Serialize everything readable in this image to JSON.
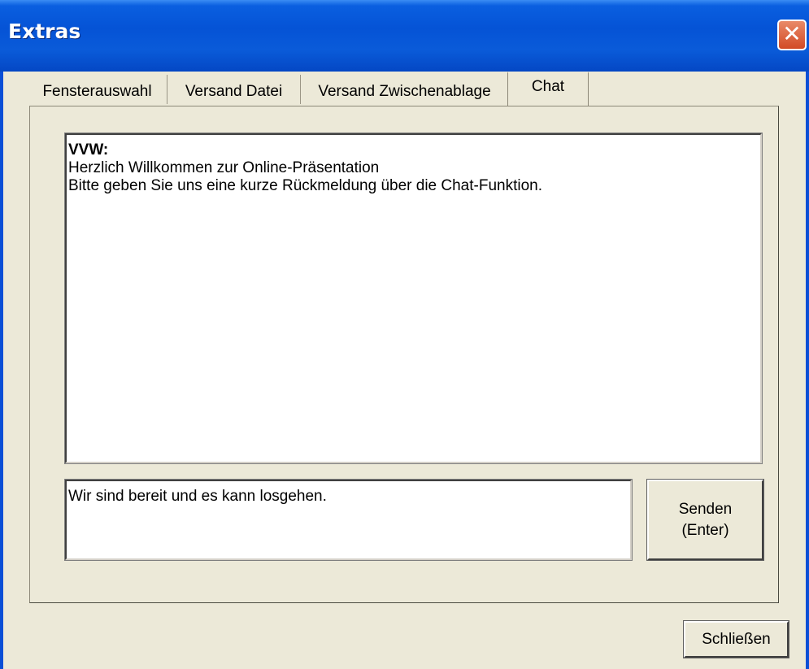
{
  "window": {
    "title": "Extras",
    "close_symbol": "✕",
    "close_icon": "close-icon",
    "titlebar_color": "#0553d6"
  },
  "tabs": [
    {
      "label": "Fensterauswahl",
      "active": false
    },
    {
      "label": "Versand Datei",
      "active": false
    },
    {
      "label": "Versand Zwischenablage",
      "active": false
    },
    {
      "label": "Chat",
      "active": true
    }
  ],
  "chat": {
    "messages": [
      {
        "sender": "VVW:",
        "lines": [
          "Herzlich Willkommen zur Online-Präsentation",
          "Bitte geben Sie uns eine kurze Rückmeldung über die Chat-Funktion."
        ]
      }
    ],
    "input_value": "Wir sind bereit und es kann losgehen.",
    "send_line1": "Senden",
    "send_line2": "(Enter)"
  },
  "footer": {
    "close_label": "Schließen"
  }
}
